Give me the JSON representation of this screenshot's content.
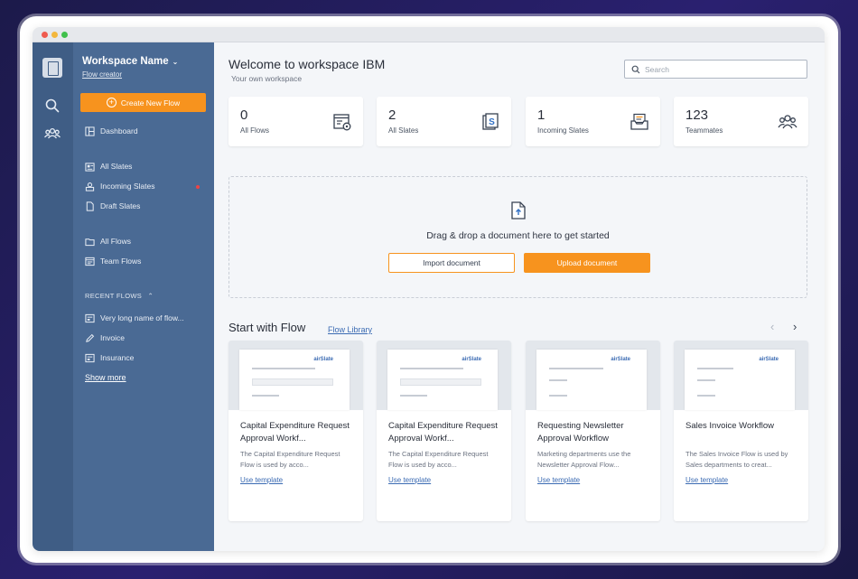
{
  "colors": {
    "accent": "#f7931e",
    "sidebar": "#4a6a94",
    "rail": "#3f5d85",
    "link": "#3b6bb3"
  },
  "workspace": {
    "name": "Workspace Name",
    "role": "Flow creator"
  },
  "sidebar": {
    "create_label": "Create New Flow",
    "items": [
      {
        "label": "Dashboard",
        "icon": "dashboard-icon"
      },
      {
        "label": "All Slates",
        "icon": "slates-icon"
      },
      {
        "label": "Incoming Slates",
        "icon": "inbox-icon"
      },
      {
        "label": "Draft Slates",
        "icon": "draft-icon"
      },
      {
        "label": "All Flows",
        "icon": "folder-icon"
      },
      {
        "label": "Team Flows",
        "icon": "team-flows-icon"
      }
    ],
    "recent_title": "RECENT FLOWS",
    "recent": [
      {
        "label": "Very long name of flow...",
        "icon": "form-icon"
      },
      {
        "label": "Invoice",
        "icon": "pencil-icon"
      },
      {
        "label": "Insurance",
        "icon": "form-icon"
      }
    ],
    "show_more": "Show more"
  },
  "header": {
    "title": "Welcome to workspace IBM",
    "subtitle": "Your own workspace"
  },
  "search": {
    "placeholder": "Search",
    "value": ""
  },
  "stats": [
    {
      "value": "0",
      "label": "All Flows",
      "icon": "flows-gear-icon"
    },
    {
      "value": "2",
      "label": "All Slates",
      "icon": "slate-s-icon"
    },
    {
      "value": "1",
      "label": "Incoming Slates",
      "icon": "inbox-tray-icon"
    },
    {
      "value": "123",
      "label": "Teammates",
      "icon": "people-icon"
    }
  ],
  "dropzone": {
    "text": "Drag & drop a document here to get started",
    "import_label": "Import document",
    "upload_label": "Upload document"
  },
  "flows": {
    "heading": "Start with Flow",
    "library_link": "Flow Library",
    "templates": [
      {
        "title": "Capital Expenditure Request Approval Workf...",
        "desc": "The Capital Expenditure Request Flow is used by acco...",
        "link": "Use template",
        "brand": "airSlate"
      },
      {
        "title": "Capital Expenditure Request Approval Workf...",
        "desc": "The Capital Expenditure Request Flow is used by acco...",
        "link": "Use template",
        "brand": "airSlate"
      },
      {
        "title": "Requesting Newsletter Approval Workflow",
        "desc": "Marketing departments use the Newsletter Approval Flow...",
        "link": "Use template",
        "brand": "airSlate"
      },
      {
        "title": "Sales Invoice Workflow",
        "desc": "The Sales Invoice Flow is used by Sales departments to creat...",
        "link": "Use template",
        "brand": "airSlate"
      }
    ]
  }
}
